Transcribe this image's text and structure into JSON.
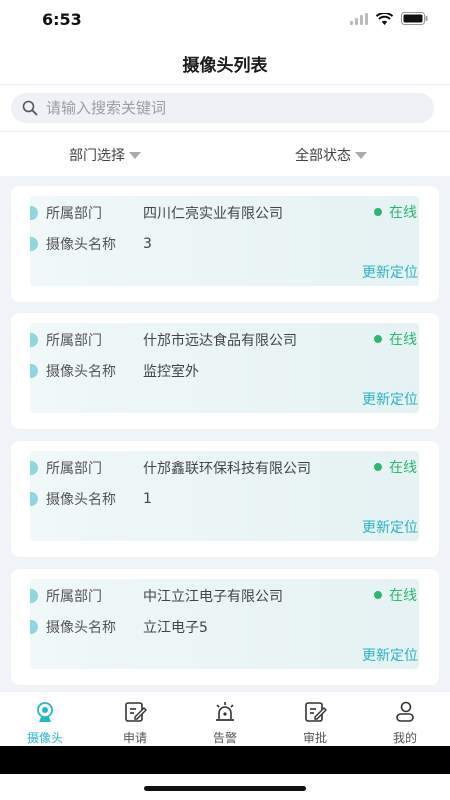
{
  "status_bar": {
    "time": "6:53"
  },
  "header": {
    "title": "摄像头列表"
  },
  "search": {
    "placeholder": "请输入搜索关键词"
  },
  "filters": {
    "department": "部门选择",
    "status": "全部状态"
  },
  "labels": {
    "department": "所属部门",
    "camera_name": "摄像头名称",
    "update_location": "更新定位"
  },
  "cameras": [
    {
      "department": "四川仁亮实业有限公司",
      "name": "3",
      "status": "在线"
    },
    {
      "department": "什邡市远达食品有限公司",
      "name": "监控室外",
      "status": "在线"
    },
    {
      "department": "什邡鑫联环保科技有限公司",
      "name": "1",
      "status": "在线"
    },
    {
      "department": "中江立江电子有限公司",
      "name": "立江电子5",
      "status": "在线"
    }
  ],
  "tabs": [
    {
      "label": "摄像头",
      "icon": "camera-icon",
      "active": true
    },
    {
      "label": "申请",
      "icon": "edit-icon"
    },
    {
      "label": "告警",
      "icon": "alarm-icon"
    },
    {
      "label": "审批",
      "icon": "approve-icon"
    },
    {
      "label": "我的",
      "icon": "user-icon"
    }
  ],
  "colors": {
    "accent": "#29b6c4",
    "online": "#2bb673"
  }
}
